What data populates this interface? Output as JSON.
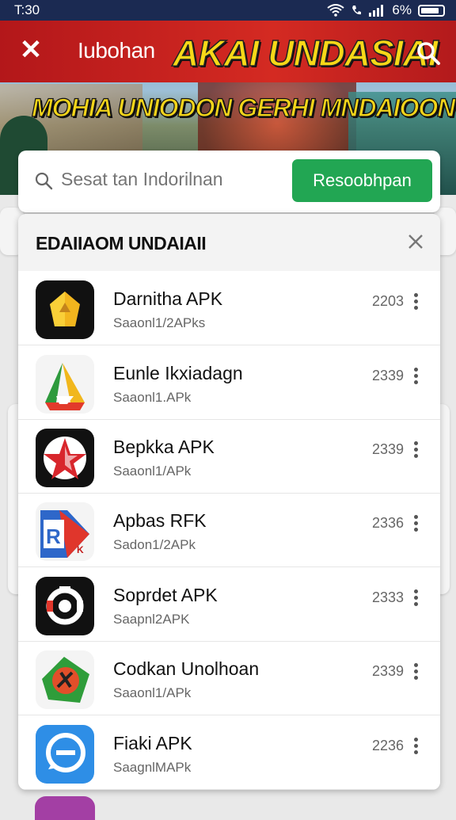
{
  "status": {
    "time": "T:30",
    "battery": "6%"
  },
  "header": {
    "app_name": "Iubohan",
    "headline": "AKAI UNDASIAI",
    "subhead": "MOHIA UNIODON GERHI MNDAIOONGN?"
  },
  "search": {
    "placeholder": "Sesat tan Indorilnan",
    "button_label": "Resoobhpan"
  },
  "panel": {
    "title": "EDAIIAOM UNDAIAII",
    "items": [
      {
        "title": "Darnitha APK",
        "sub": "Saaonl1/2APks",
        "count": "2203",
        "icon": "gold-star-app-icon"
      },
      {
        "title": "Eunle Ikxiadagn",
        "sub": "Saaonl1.APk",
        "count": "2339",
        "icon": "triangle-app-icon"
      },
      {
        "title": "Bepkka APK",
        "sub": "Saaonl1/APk",
        "count": "2339",
        "icon": "red-star-app-icon"
      },
      {
        "title": "Apbas RFK",
        "sub": "Sadon1/2APk",
        "count": "2336",
        "icon": "r-arrow-app-icon"
      },
      {
        "title": "Soprdet APK",
        "sub": "Saapnl2APK",
        "count": "2333",
        "icon": "lens-app-icon"
      },
      {
        "title": "Codkan Unolhoan",
        "sub": "Saaonl1/APk",
        "count": "2339",
        "icon": "shield-app-icon"
      },
      {
        "title": "Fiaki APK",
        "sub": "SaagnlMAPk",
        "count": "2236",
        "icon": "chat-app-icon"
      }
    ]
  }
}
